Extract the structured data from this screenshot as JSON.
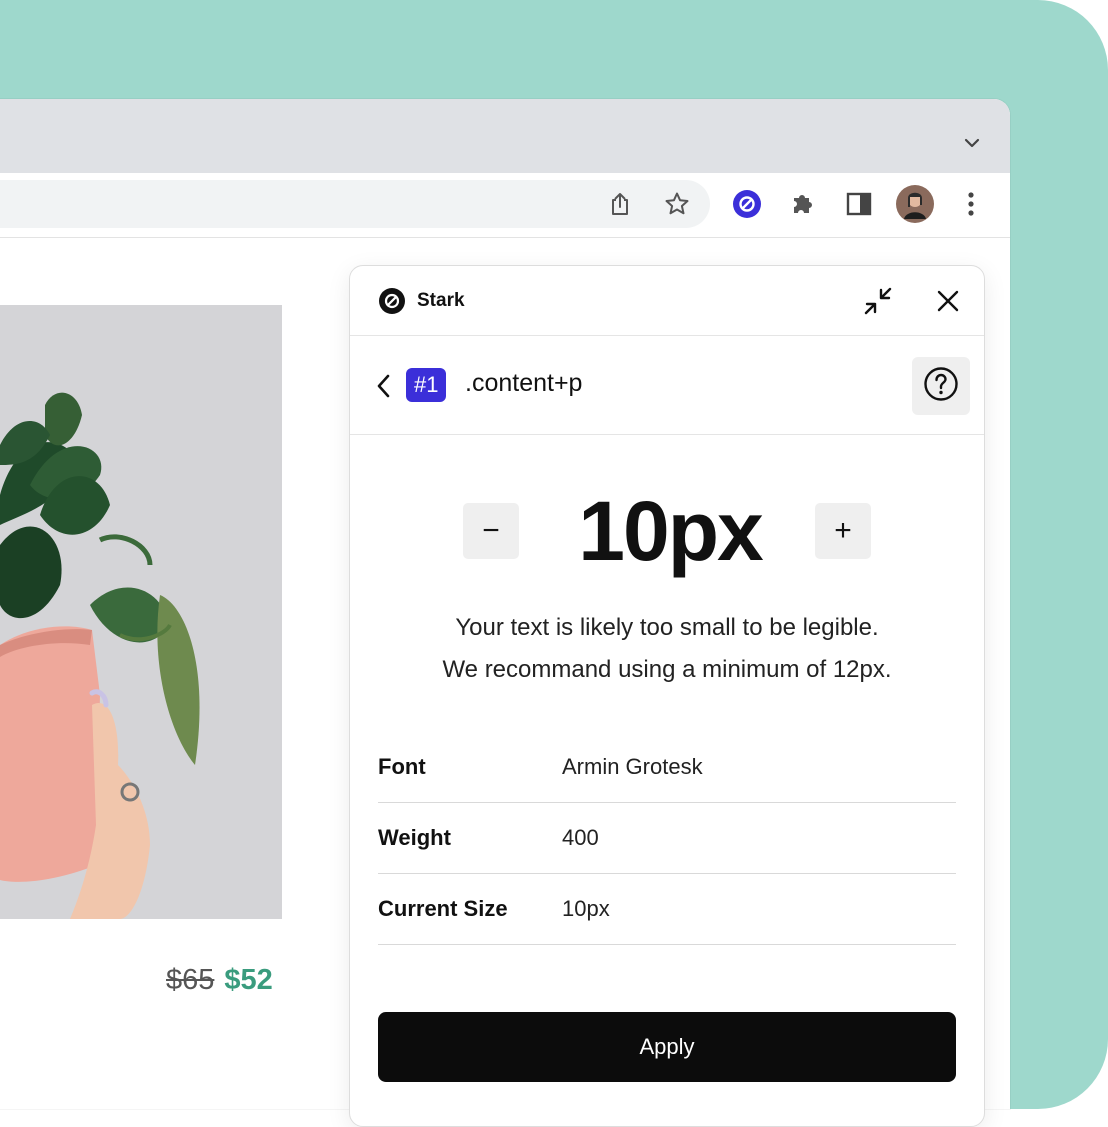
{
  "colors": {
    "background": "#9ed8cc",
    "accent": "#3b2fd9",
    "price_new": "#3a9c7e",
    "apply_button": "#0c0c0c"
  },
  "browser": {
    "toolbar_icons": [
      "share-icon",
      "star-icon",
      "stark-extension-icon",
      "puzzle-icon",
      "sidepanel-icon",
      "avatar",
      "more-icon"
    ]
  },
  "product": {
    "price_old": "$65",
    "price_new": "$52"
  },
  "stark": {
    "name": "Stark",
    "issue_number": "#1",
    "selector": ".content+p",
    "font_size": "10px",
    "decrease_label": "−",
    "increase_label": "+",
    "message_line1": "Your text is likely too small to be legible.",
    "message_line2": "We recommand using a minimum of 12px.",
    "properties": [
      {
        "label": "Font",
        "value": "Armin Grotesk"
      },
      {
        "label": "Weight",
        "value": "400"
      },
      {
        "label": "Current Size",
        "value": "10px"
      }
    ],
    "apply_label": "Apply"
  }
}
